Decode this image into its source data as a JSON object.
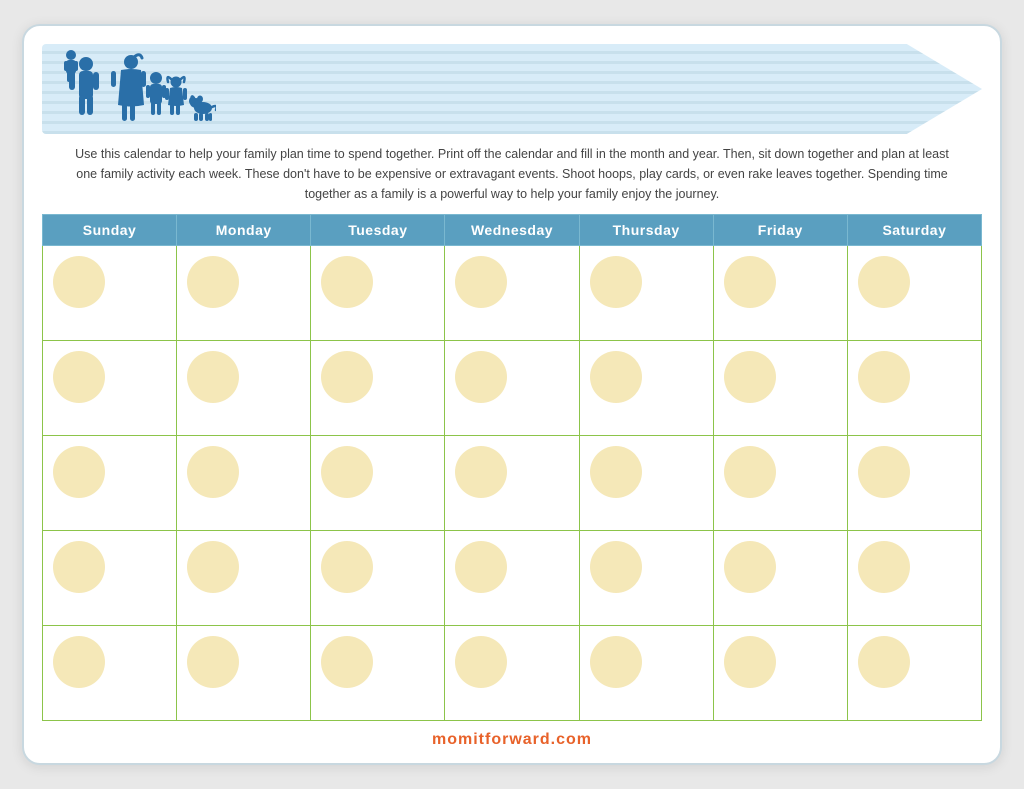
{
  "header": {
    "description": "Use this calendar to help your family plan time to spend together. Print off the calendar and fill in the month and year. Then, sit down together and plan at least one family activity each week. These don't have to be expensive or extravagant events. Shoot hoops, play cards, or even rake leaves together. Spending time together as a family is a powerful way to help your family enjoy the journey."
  },
  "calendar": {
    "days": [
      "Sunday",
      "Monday",
      "Tuesday",
      "Wednesday",
      "Thursday",
      "Friday",
      "Saturday"
    ],
    "rows": 5
  },
  "footer": {
    "url": "momitforward.com"
  },
  "colors": {
    "header_bg": "#c8e0ec",
    "header_stripe": "#d8ecf8",
    "day_header_bg": "#5a9fc0",
    "day_header_text": "#fff",
    "cell_border": "#8cc44a",
    "dot_fill": "#f5e8b8",
    "footer_text": "#e8622a"
  }
}
